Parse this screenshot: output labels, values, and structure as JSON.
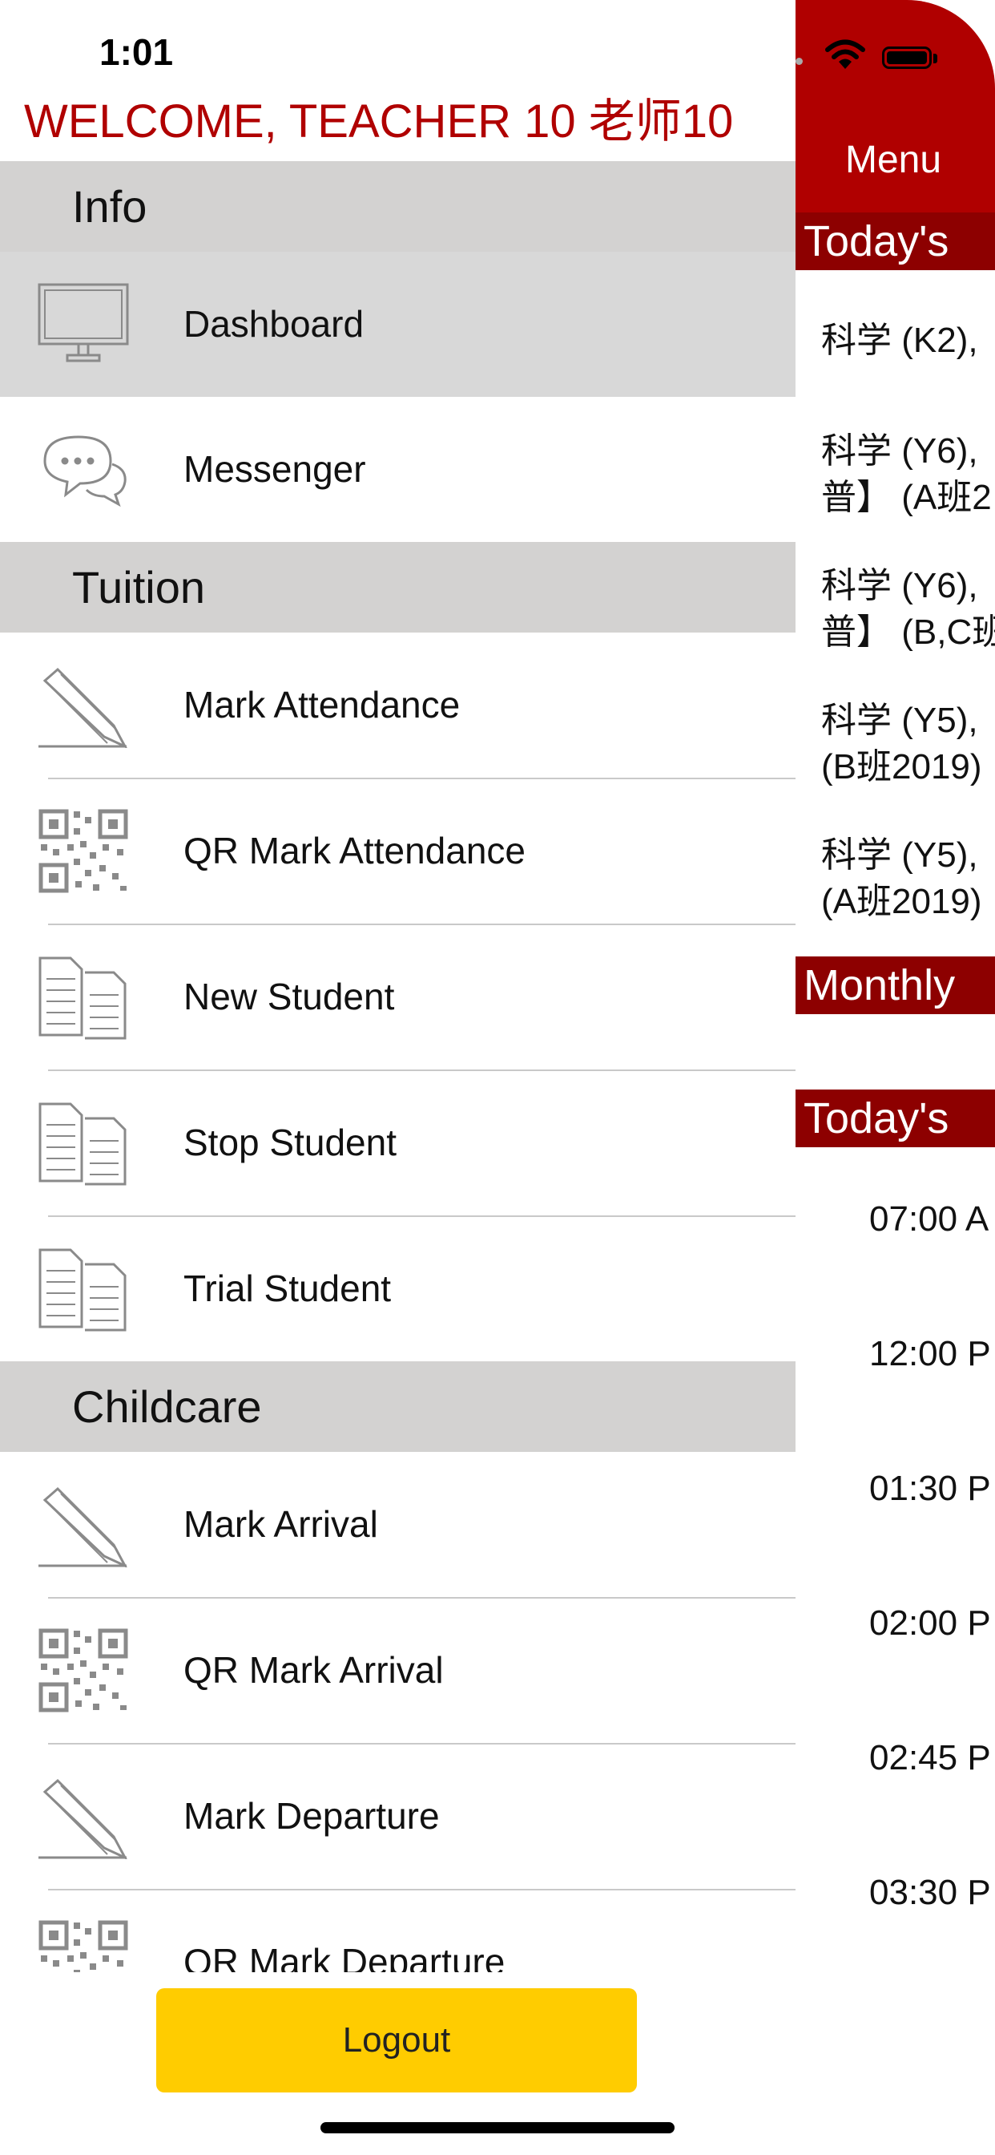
{
  "status_bar": {
    "time": "1:01"
  },
  "drawer": {
    "welcome": "WELCOME, TEACHER 10 老师10",
    "sections": [
      {
        "title": "Info",
        "items": [
          {
            "label": "Dashboard",
            "icon": "monitor-icon",
            "active": true
          },
          {
            "label": "Messenger",
            "icon": "chat-bubbles-icon"
          }
        ]
      },
      {
        "title": "Tuition",
        "items": [
          {
            "label": "Mark Attendance",
            "icon": "pencil-icon"
          },
          {
            "label": "QR Mark Attendance",
            "icon": "qr-code-icon"
          },
          {
            "label": "New Student",
            "icon": "documents-icon"
          },
          {
            "label": "Stop Student",
            "icon": "documents-icon"
          },
          {
            "label": "Trial Student",
            "icon": "documents-icon"
          }
        ]
      },
      {
        "title": "Childcare",
        "items": [
          {
            "label": "Mark Arrival",
            "icon": "pencil-icon"
          },
          {
            "label": "QR Mark Arrival",
            "icon": "qr-code-icon"
          },
          {
            "label": "Mark Departure",
            "icon": "pencil-icon"
          },
          {
            "label": "QR Mark Departure",
            "icon": "qr-code-icon"
          }
        ]
      }
    ],
    "logout_label": "Logout"
  },
  "dashboard": {
    "menu_label": "Menu",
    "todays_classes_title": "Today's",
    "classes": [
      [
        "科学 (K2),"
      ],
      [
        "科学 (Y6),",
        "普】 (A班2"
      ],
      [
        "科学 (Y6),",
        "普】 (B,C班"
      ],
      [
        "科学 (Y5),",
        "(B班2019)"
      ],
      [
        "科学 (Y5),",
        "(A班2019)"
      ]
    ],
    "monthly_title": "Monthly",
    "todays_schedule_title": "Today's",
    "times": [
      "07:00 A",
      "12:00 P",
      "01:30 P",
      "02:00 P",
      "02:45 P",
      "03:30 P"
    ]
  },
  "colors": {
    "brand_red": "#b00000",
    "dark_red": "#8d0000",
    "logout_yellow": "#ffcc00"
  }
}
